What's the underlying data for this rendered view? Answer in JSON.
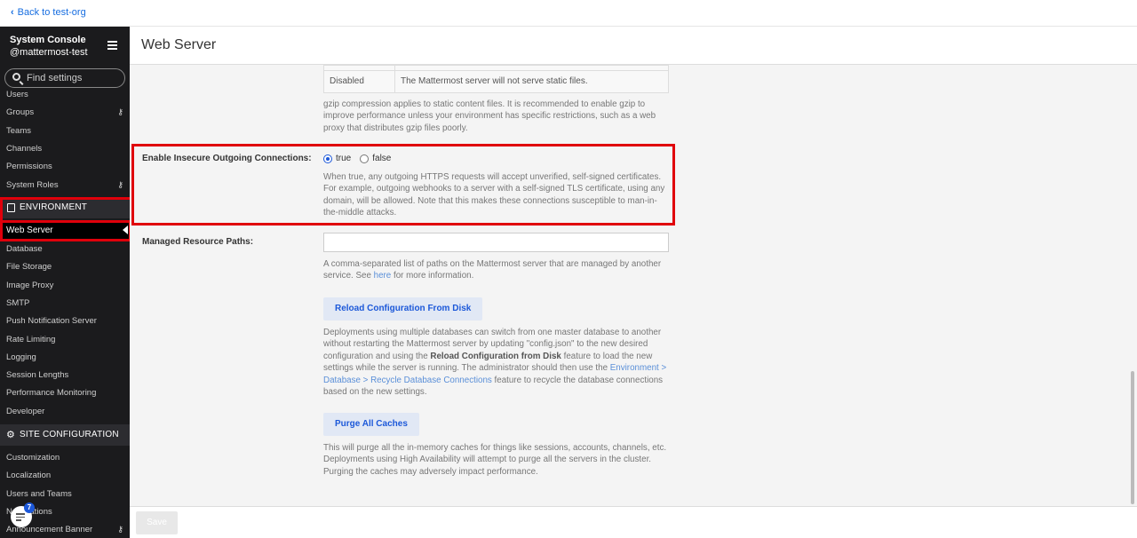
{
  "topbar": {
    "back_label": "Back to test-org"
  },
  "sidebar": {
    "title": "System Console",
    "subtitle": "@mattermost-test",
    "search_placeholder": "Find settings",
    "items_top": [
      "Users",
      "Groups",
      "Teams",
      "Channels",
      "Permissions",
      "System Roles"
    ],
    "section_env": "ENVIRONMENT",
    "active_item": "Web Server",
    "items_env": [
      "Database",
      "File Storage",
      "Image Proxy",
      "SMTP",
      "Push Notification Server",
      "Rate Limiting",
      "Logging",
      "Session Lengths",
      "Performance Monitoring",
      "Developer"
    ],
    "section_site": "SITE CONFIGURATION",
    "items_site": [
      "Customization",
      "Localization",
      "Users and Teams",
      "Notifications",
      "Announcement Banner"
    ],
    "badge_count": "7"
  },
  "main": {
    "title": "Web Server",
    "table_row_label": "Disabled",
    "table_row_desc": "The Mattermost server will not serve static files.",
    "gzip_help": "gzip compression applies to static content files. It is recommended to enable gzip to improve performance unless your environment has specific restrictions, such as a web proxy that distributes gzip files poorly.",
    "insecure_label": "Enable Insecure Outgoing Connections:",
    "radio_true": "true",
    "radio_false": "false",
    "insecure_help": "When true, any outgoing HTTPS requests will accept unverified, self-signed certificates. For example, outgoing webhooks to a server with a self-signed TLS certificate, using any domain, will be allowed. Note that this makes these connections susceptible to man-in-the-middle attacks.",
    "managed_label": "Managed Resource Paths:",
    "managed_value": "",
    "managed_help_pre": "A comma-separated list of paths on the Mattermost server that are managed by another service. See ",
    "managed_help_link": "here",
    "managed_help_post": " for more information.",
    "reload_button": "Reload Configuration From Disk",
    "reload_help_1": "Deployments using multiple databases can switch from one master database to another without restarting the Mattermost server by updating \"config.json\" to the new desired configuration and using the ",
    "reload_help_bold": "Reload Configuration from Disk",
    "reload_help_2": " feature to load the new settings while the server is running. The administrator should then use the ",
    "reload_help_link": "Environment > Database > Recycle Database Connections",
    "reload_help_3": " feature to recycle the database connections based on the new settings.",
    "purge_button": "Purge All Caches",
    "purge_help": "This will purge all the in-memory caches for things like sessions, accounts, channels, etc. Deployments using High Availability will attempt to purge all the servers in the cluster. Purging the caches may adversely impact performance.",
    "save_button": "Save"
  }
}
